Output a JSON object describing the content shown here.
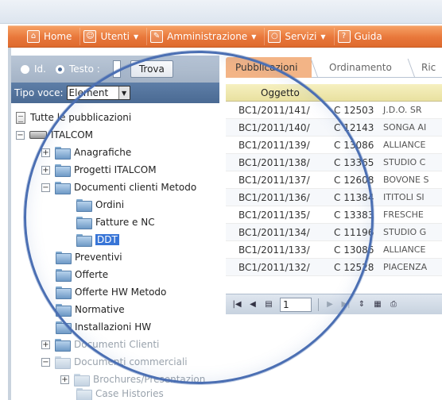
{
  "menu": {
    "items": [
      {
        "label": "Home",
        "icon": "home-icon",
        "glyph": "⌂",
        "caret": false
      },
      {
        "label": "Utenti",
        "icon": "user-icon",
        "glyph": "👤",
        "caret": true
      },
      {
        "label": "Amministrazione",
        "icon": "wrench-icon",
        "glyph": "✎",
        "caret": true
      },
      {
        "label": "Servizi",
        "icon": "services-icon",
        "glyph": "◯",
        "caret": true
      },
      {
        "label": "Guida",
        "icon": "help-icon",
        "glyph": "?",
        "caret": false
      }
    ]
  },
  "search": {
    "radio_id": "Id.",
    "radio_text": "Testo :",
    "button": "Trova"
  },
  "type_filter": {
    "label": "Tipo voce:",
    "selected": "Element"
  },
  "tree": {
    "root": "Tutte le pubblicazioni",
    "nodes": [
      "ITALCOM",
      "Anagrafiche",
      "Progetti ITALCOM",
      "Documenti clienti Metodo",
      "Ordini",
      "Fatture e NC",
      "DDT",
      "Preventivi",
      "Offerte",
      "Offerte HW Metodo",
      "Normative",
      "Installazioni HW",
      "Documenti Clienti",
      "Documenti commerciali",
      "Brochures/Presentazion",
      "Case Histories"
    ],
    "expanders": [
      "−",
      "+",
      "+",
      "−",
      "+",
      "−",
      "+"
    ]
  },
  "tabs": [
    "Pubblicazioni",
    "Ordinamento",
    "Ric"
  ],
  "grid": {
    "header": "Oggetto",
    "rows": [
      [
        "BC1/2011/141/",
        "C 12503",
        "J.D.O. SR"
      ],
      [
        "BC1/2011/140/",
        "C 12143",
        "SONGA AI"
      ],
      [
        "BC1/2011/139/",
        "C 13086",
        "ALLIANCE"
      ],
      [
        "BC1/2011/138/",
        "C 13365",
        "STUDIO C"
      ],
      [
        "BC1/2011/137/",
        "C 12608",
        "BOVONE S"
      ],
      [
        "BC1/2011/136/",
        "C 11384",
        "ITITOLI SI"
      ],
      [
        "BC1/2011/135/",
        "C 13383",
        "FRESCHE"
      ],
      [
        "BC1/2011/134/",
        "C 11196",
        "STUDIO G"
      ],
      [
        "BC1/2011/133/",
        "C 13086",
        "ALLIANCE"
      ],
      [
        "BC1/2011/132/",
        "C 12528",
        "PIACENZA"
      ]
    ]
  },
  "pager": {
    "page": "1"
  },
  "colors": {
    "menu_orange": "#e8773a",
    "panel_blue": "#4a6a93",
    "selected": "#3875d7",
    "lens_border": "#4b6fb3"
  }
}
